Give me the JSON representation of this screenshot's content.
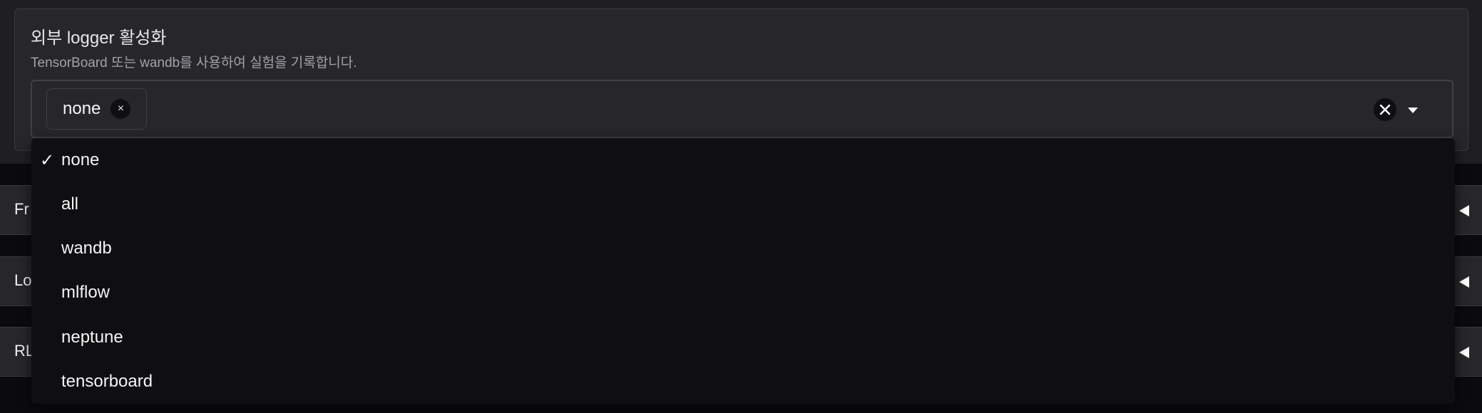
{
  "logger": {
    "title": "외부 logger 활성화",
    "description": "TensorBoard 또는 wandb를 사용하여 실험을 기록합니다.",
    "selected_token": "none",
    "token_remove_glyph": "×"
  },
  "dropdown": {
    "checkmark": "✓",
    "options": [
      {
        "label": "none"
      },
      {
        "label": "all"
      },
      {
        "label": "wandb"
      },
      {
        "label": "mlflow"
      },
      {
        "label": "neptune"
      },
      {
        "label": "tensorboard"
      }
    ]
  },
  "accordions": [
    {
      "label": "Fr"
    },
    {
      "label": "Lo"
    },
    {
      "label": "RL"
    }
  ],
  "colors": {
    "background": "#0b0b0f",
    "panel": "#27272a",
    "dropdown": "#0f0f12",
    "text": "#f4f4f5",
    "muted_text": "#a1a1aa"
  }
}
